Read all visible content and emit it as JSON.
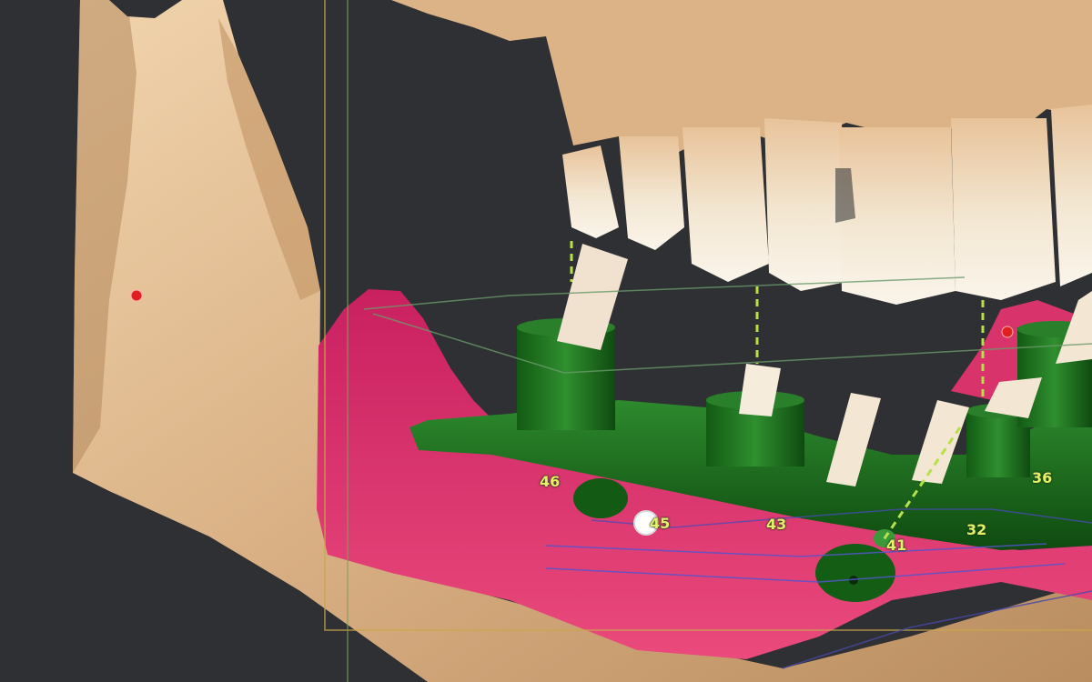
{
  "viewer": {
    "background_color": "#2f3033",
    "bone_color": "#e0b98c",
    "soft_tissue_color": "#e0386f",
    "surgical_guide_color": "#1e6b1e",
    "planned_axis_color": "#b8e04a",
    "landmark_color": "#e02020"
  },
  "implant_labels": [
    {
      "id": "46",
      "text": "46"
    },
    {
      "id": "45",
      "text": "45"
    },
    {
      "id": "43",
      "text": "43"
    },
    {
      "id": "41",
      "text": "41"
    },
    {
      "id": "32",
      "text": "32"
    },
    {
      "id": "36",
      "text": "36"
    }
  ]
}
